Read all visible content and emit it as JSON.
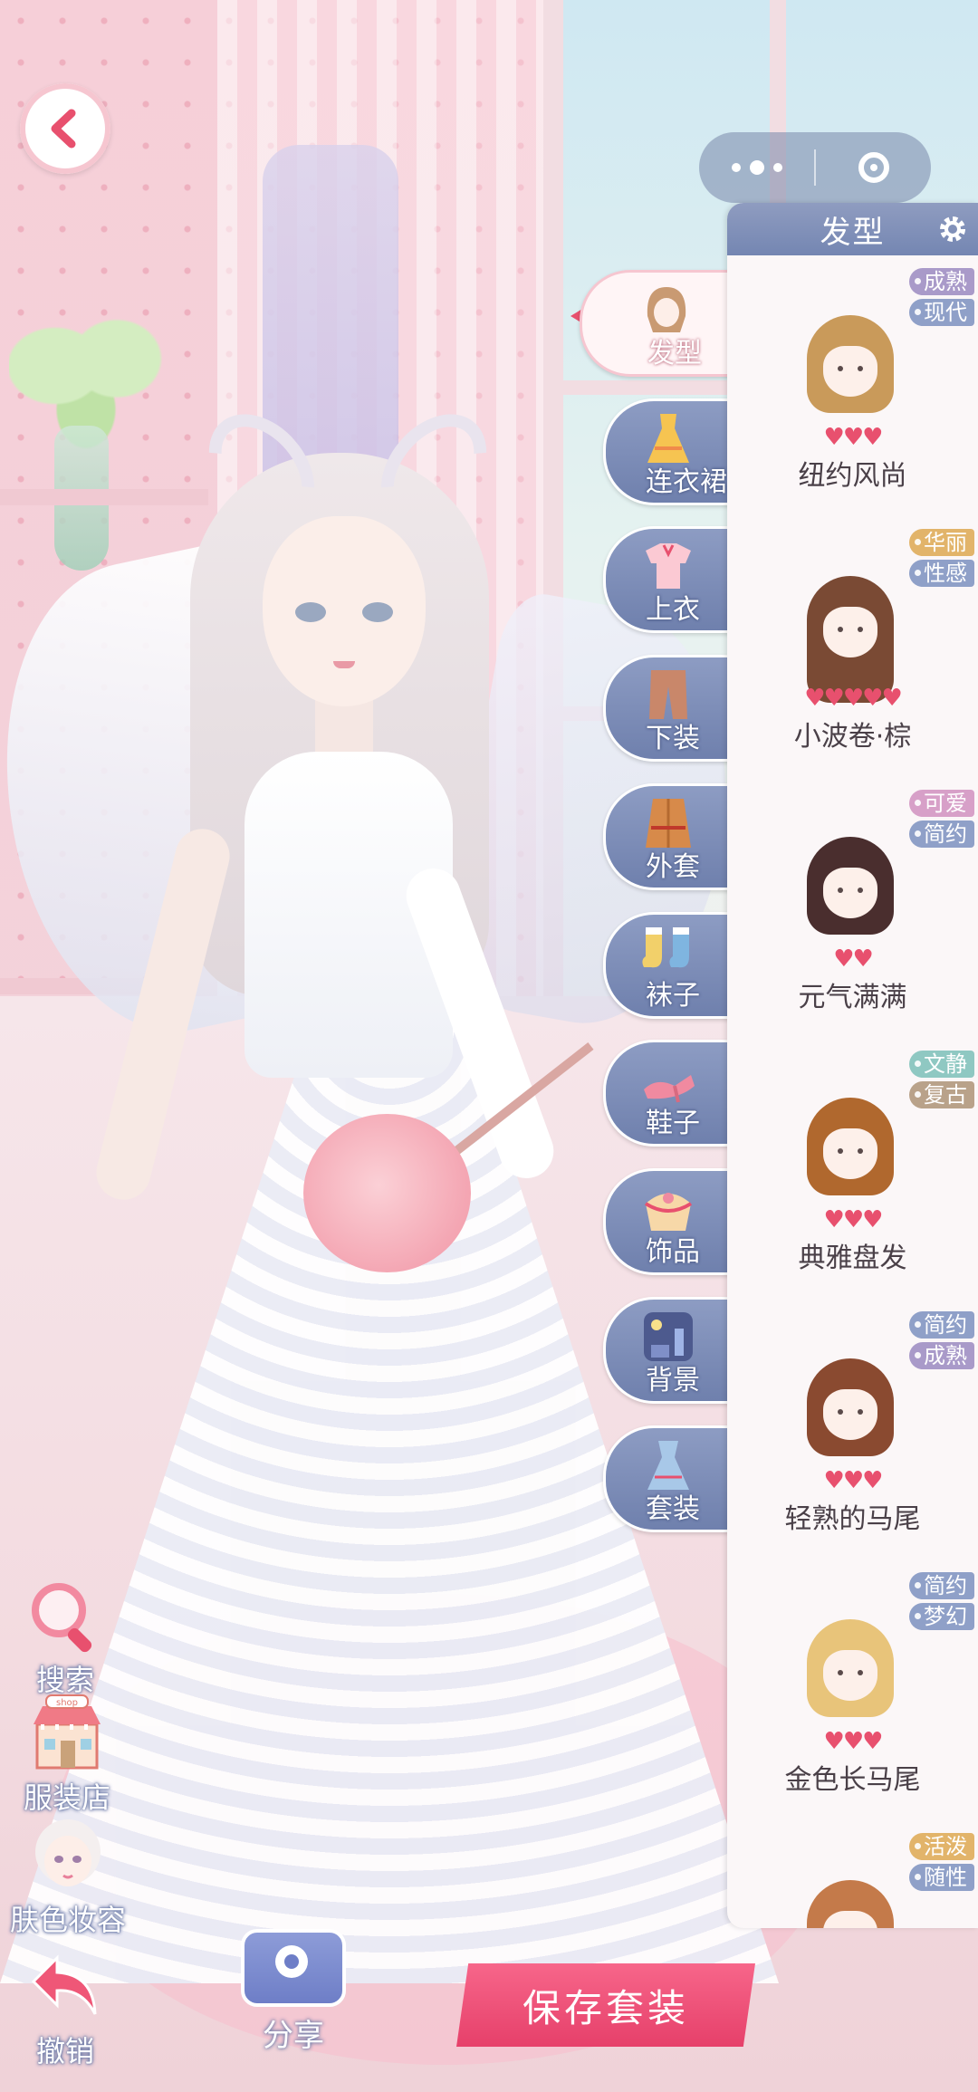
{
  "back_button": {
    "icon": "chevron-left-icon"
  },
  "capsule": {
    "more_icon": "more-dots-icon",
    "close_icon": "target-circle-icon"
  },
  "panel": {
    "title": "发型",
    "settings_icon": "gear-icon",
    "items": [
      {
        "name": "纽约风尚",
        "hearts": "♥♥♥",
        "tags": [
          "成熟",
          "现代"
        ]
      },
      {
        "name": "小波卷·棕",
        "hearts": "♥♥♥♥♥",
        "tags": [
          "华丽",
          "性感"
        ]
      },
      {
        "name": "元气满满",
        "hearts": "♥♥",
        "tags": [
          "可爱",
          "简约"
        ]
      },
      {
        "name": "典雅盘发",
        "hearts": "♥♥♥",
        "tags": [
          "文静",
          "复古"
        ]
      },
      {
        "name": "轻熟的马尾",
        "hearts": "♥♥♥",
        "tags": [
          "简约",
          "成熟"
        ]
      },
      {
        "name": "金色长马尾",
        "hearts": "♥♥♥",
        "tags": [
          "简约",
          "梦幻"
        ]
      },
      {
        "name": "",
        "hearts": "",
        "tags": [
          "活泼",
          "随性"
        ]
      }
    ]
  },
  "categories": [
    {
      "label": "发型",
      "icon": "hairstyle-icon",
      "active": true
    },
    {
      "label": "连衣裙",
      "icon": "dress-icon"
    },
    {
      "label": "上衣",
      "icon": "top-shirt-icon"
    },
    {
      "label": "下装",
      "icon": "pants-icon"
    },
    {
      "label": "外套",
      "icon": "coat-icon"
    },
    {
      "label": "袜子",
      "icon": "socks-icon"
    },
    {
      "label": "鞋子",
      "icon": "shoes-icon"
    },
    {
      "label": "饰品",
      "icon": "accessory-box-icon"
    },
    {
      "label": "背景",
      "icon": "background-scene-icon"
    },
    {
      "label": "套装",
      "icon": "outfit-set-icon"
    }
  ],
  "tools": {
    "search": {
      "label": "搜索",
      "icon": "magnifier-icon"
    },
    "shop": {
      "label": "服装店",
      "icon": "shop-icon",
      "sign": "shop"
    },
    "makeup": {
      "label": "肤色妆容",
      "icon": "face-makeup-icon"
    },
    "undo": {
      "label": "撤销",
      "icon": "undo-arrow-icon"
    }
  },
  "share": {
    "label": "分享",
    "icon": "camera-icon"
  },
  "save_button": {
    "label": "保存套装"
  },
  "colors": {
    "accent_pink": "#e8506e",
    "panel_blue": "#7486b2",
    "save_pink": "#f7668a"
  }
}
